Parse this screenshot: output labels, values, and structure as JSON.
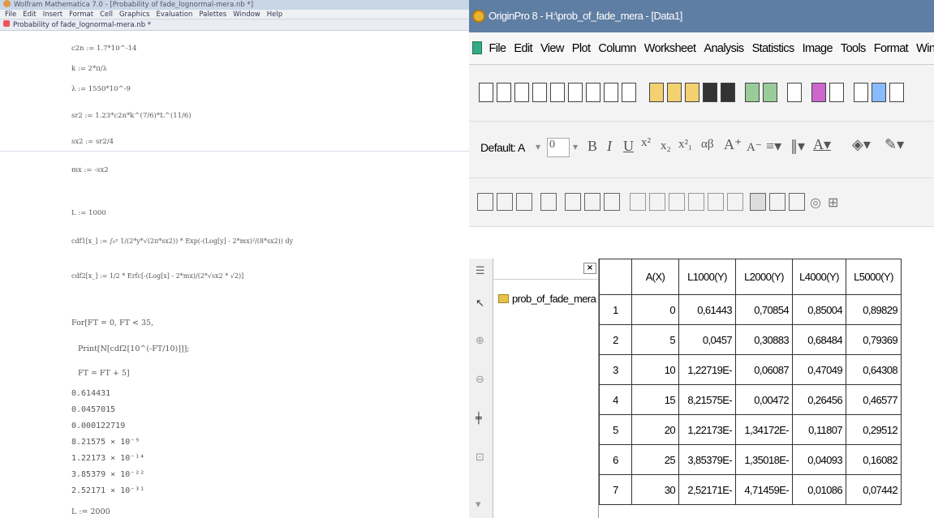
{
  "mathematica": {
    "window_title": "Wolfram Mathematica 7.0 - [Probability of fade_lognormal-mera.nb *]",
    "menu": [
      "File",
      "Edit",
      "Insert",
      "Format",
      "Cell",
      "Graphics",
      "Evaluation",
      "Palettes",
      "Window",
      "Help"
    ],
    "notebook_title": "Probability of fade_lognormal-mera.nb *",
    "cells": [
      "c2n := 1.7*10^-14",
      "k := 2*π/λ",
      "λ := 1550*10^-9",
      "sr2 := 1.23*c2n*k^(7/6)*L^(11/6)",
      "sx2 := sr2/4",
      "mx := -sx2",
      "L := 1000",
      "cdf1[x_] := ∫₀ˣ 1/(2*y*√(2π*sx2)) * Exp(-(Log[y] - 2*mx)²/(8*sx2)) dy",
      "cdf2[x_] := 1/2 * Erfc[-(Log[x] - 2*mx)/(2*√sx2 * √2)]",
      "For[FT = 0, FT < 35,",
      "Print[N[cdf2[10^(-FT/10)]]];",
      "FT = FT + 5]"
    ],
    "outputs": [
      "0.614431",
      "0.0457015",
      "0.000122719",
      "8.21575 × 10⁻⁹",
      "1.22173 × 10⁻¹⁴",
      "3.85379 × 10⁻²²",
      "2.52171 × 10⁻³¹"
    ],
    "last_cell": "L := 2000"
  },
  "origin": {
    "window_title": "OriginPro 8 - H:\\prob_of_fade_mera - [Data1]",
    "menu": [
      "File",
      "Edit",
      "View",
      "Plot",
      "Column",
      "Worksheet",
      "Analysis",
      "Statistics",
      "Image",
      "Tools",
      "Format",
      "Wind"
    ],
    "font_box": "Default: A",
    "size_box": "0",
    "folder_name": "prob_of_fade_mera",
    "columns": [
      "A(X)",
      "L1000(Y)",
      "L2000(Y)",
      "L4000(Y)",
      "L5000(Y)"
    ],
    "rows": [
      {
        "n": "1",
        "cells": [
          "0",
          "0,61443",
          "0,70854",
          "0,85004",
          "0,89829"
        ]
      },
      {
        "n": "2",
        "cells": [
          "5",
          "0,0457",
          "0,30883",
          "0,68484",
          "0,79369"
        ]
      },
      {
        "n": "3",
        "cells": [
          "10",
          "1,22719E-",
          "0,06087",
          "0,47049",
          "0,64308"
        ]
      },
      {
        "n": "4",
        "cells": [
          "15",
          "8,21575E-",
          "0,00472",
          "0,26456",
          "0,46577"
        ]
      },
      {
        "n": "5",
        "cells": [
          "20",
          "1,22173E-",
          "1,34172E-",
          "0,11807",
          "0,29512"
        ]
      },
      {
        "n": "6",
        "cells": [
          "25",
          "3,85379E-",
          "1,35018E-",
          "0,04093",
          "0,16082"
        ]
      },
      {
        "n": "7",
        "cells": [
          "30",
          "2,52171E-",
          "4,71459E-",
          "0,01086",
          "0,07442"
        ]
      }
    ]
  }
}
